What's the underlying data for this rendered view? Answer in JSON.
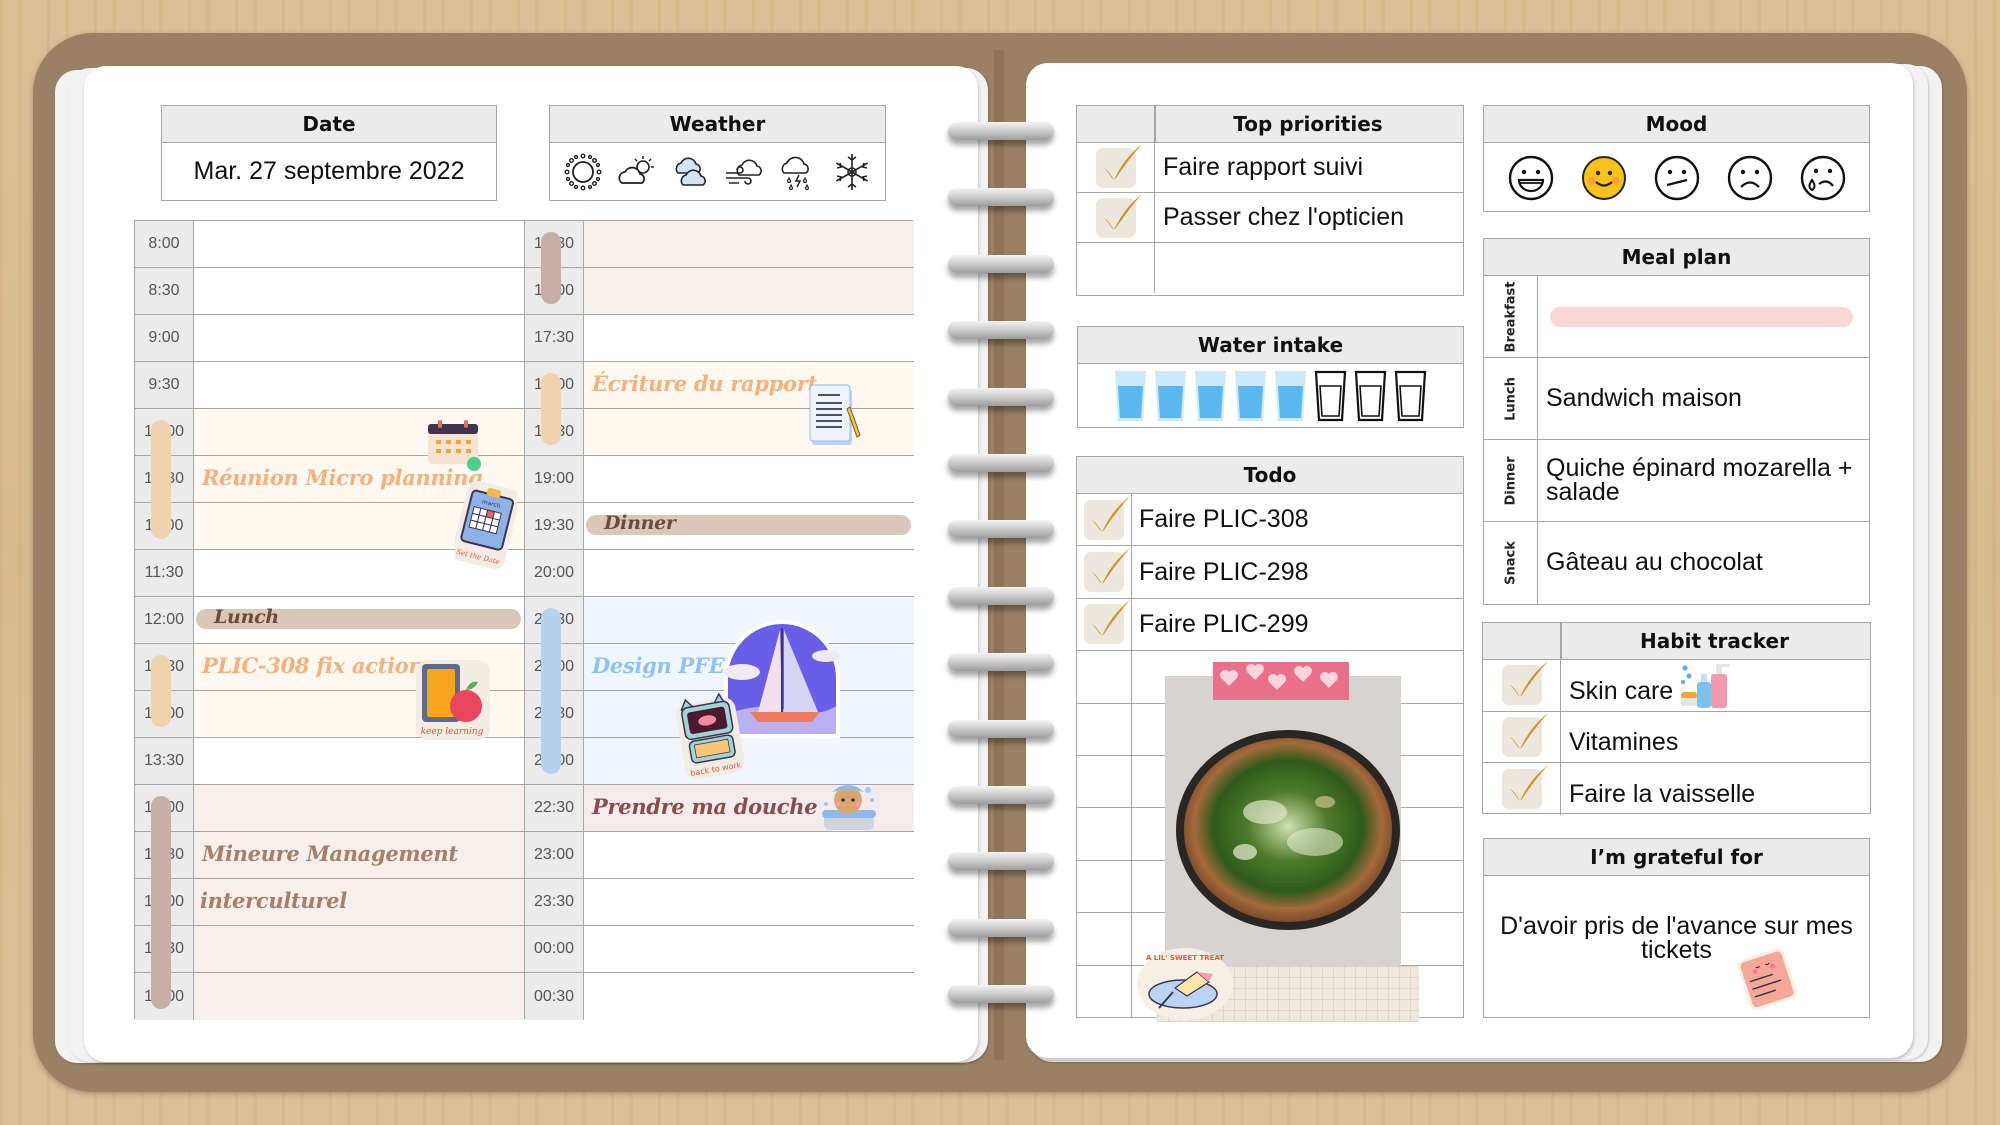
{
  "date_box": {
    "header": "Date",
    "value": "Mar. 27 septembre 2022"
  },
  "weather_box": {
    "header": "Weather",
    "icons": [
      "sun-icon",
      "partly-sunny-icon",
      "cloudy-icon",
      "windy-icon",
      "thunderstorm-rain-icon",
      "snowflake-icon"
    ],
    "selected": "cloudy-icon",
    "selected_color": "#cfe4f5"
  },
  "schedule": {
    "left_times": [
      "8:00",
      "8:30",
      "9:00",
      "9:30",
      "10:00",
      "10:30",
      "11:00",
      "11:30",
      "12:00",
      "12:30",
      "13:00",
      "13:30",
      "14:00",
      "14:30",
      "15:00",
      "15:30",
      "16:00"
    ],
    "right_times": [
      "16:30",
      "17:00",
      "17:30",
      "18:00",
      "18:30",
      "19:00",
      "19:30",
      "20:00",
      "20:30",
      "21:00",
      "21:30",
      "22:00",
      "22:30",
      "23:00",
      "23:30",
      "00:00",
      "00:30"
    ],
    "events": [
      {
        "title": "Réunion Micro planning",
        "start": "10:00",
        "end": "11:30",
        "color": "#f5b07c",
        "fill": "#fdf8f0",
        "bar": "#efd3ae",
        "sticker": "calendar-set-the-date-sticker"
      },
      {
        "title": "Lunch",
        "start": "12:00",
        "end": "12:30",
        "color": "#6e4a38",
        "fill": "#d9c7b8",
        "style": "pill"
      },
      {
        "title": "PLIC-308 fix actions",
        "start": "12:30",
        "end": "13:30",
        "color": "#f5b07c",
        "fill": "#fdf8f0",
        "bar": "#efd3ae",
        "sticker": "keep-learning-sticker"
      },
      {
        "title": "Mineure Management",
        "subtitle": "interculturel",
        "start": "14:00",
        "end": "17:30",
        "color": "#a97d66",
        "fill": "#f5f0ec",
        "bar": "#c8aea4"
      },
      {
        "title": "Écriture du rapport",
        "start": "18:00",
        "end": "19:00",
        "color": "#f5b07c",
        "fill": "#fdf8f0",
        "bar": "#efd3ae",
        "sticker": "document-pencil-sticker"
      },
      {
        "title": "Dinner",
        "start": "19:30",
        "end": "20:00",
        "color": "#6e4a38",
        "fill": "#d9c7b8",
        "style": "pill"
      },
      {
        "title": "Design PFEE",
        "start": "20:30",
        "end": "22:30",
        "color": "#8ec3f0",
        "fill": "#f0f6fd",
        "bar": "#b3d3f1",
        "sticker": "sailboat-and-laptop-sticker",
        "sticker_caption": "back to work"
      },
      {
        "title": "Prendre ma douche",
        "start": "22:30",
        "end": "23:00",
        "color": "#8e4a4a",
        "fill": "#f3ecec",
        "sticker": "dog-bath-sticker"
      }
    ],
    "sticker_captions": {
      "calendar": "Set the Date",
      "calendar_month": "march",
      "keep_learning": "keep learning",
      "back_to_work": "back to work"
    }
  },
  "top_priorities": {
    "header": "Top priorities",
    "items": [
      {
        "text": "Faire rapport suivi",
        "checked": true
      },
      {
        "text": "Passer chez l'opticien",
        "checked": true
      },
      {
        "text": "",
        "checked": false
      }
    ]
  },
  "water_intake": {
    "header": "Water intake",
    "glasses_total": 8,
    "glasses_filled": 5
  },
  "todo": {
    "header": "Todo",
    "items": [
      {
        "text": "Faire PLIC-308",
        "checked": true
      },
      {
        "text": "Faire PLIC-298",
        "checked": true
      },
      {
        "text": "Faire PLIC-299",
        "checked": true
      },
      {
        "text": "",
        "checked": false
      },
      {
        "text": "",
        "checked": false
      },
      {
        "text": "",
        "checked": false
      },
      {
        "text": "",
        "checked": false
      },
      {
        "text": "",
        "checked": false
      },
      {
        "text": "",
        "checked": false
      },
      {
        "text": "",
        "checked": false
      }
    ],
    "photo": "quiche-photo",
    "photo_sticker_caption": "A LIL' SWEET TREAT"
  },
  "mood": {
    "header": "Mood",
    "faces": [
      "laughing-face-icon",
      "smiling-face-icon",
      "neutral-face-icon",
      "sad-face-icon",
      "crying-face-icon"
    ],
    "selected": "smiling-face-icon",
    "selected_color": "#f7c21a"
  },
  "meal_plan": {
    "header": "Meal plan",
    "meals": [
      {
        "label": "Breakfast",
        "text": "",
        "highlight": "#fad6d6"
      },
      {
        "label": "Lunch",
        "text": "Sandwich maison"
      },
      {
        "label": "Dinner",
        "text": "Quiche épinard mozarella + salade"
      },
      {
        "label": "Snack",
        "text": "Gâteau au chocolat"
      }
    ]
  },
  "habit_tracker": {
    "header": "Habit tracker",
    "items": [
      {
        "text": "Skin care",
        "checked": true,
        "sticker": "skincare-bottles-sticker"
      },
      {
        "text": "Vitamines",
        "checked": true
      },
      {
        "text": "Faire la vaisselle",
        "checked": true
      }
    ]
  },
  "grateful": {
    "header": "I’m grateful for",
    "text": "D'avoir pris de l'avance sur mes tickets",
    "sticker": "cute-note-sticker"
  },
  "colors": {
    "check": "#c9962a",
    "check_bg": "#ece6dc",
    "cover": "#9a8164",
    "header_bg": "#ebebeb",
    "border": "#a6a6a6"
  }
}
